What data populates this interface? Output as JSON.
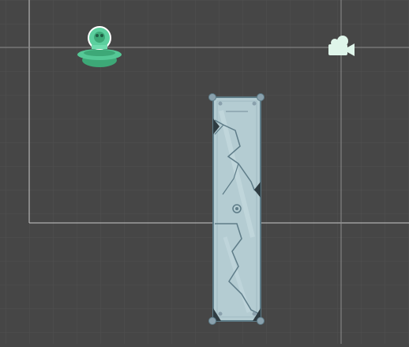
{
  "scene": {
    "view": "scene-view",
    "grid": true,
    "colors": {
      "background": "#464646",
      "grid_line": "#505050",
      "camera_bounds": "#c8c8c8",
      "gizmo_green": "#4fbf8f",
      "camera_icon": "#dff5ea",
      "tile_fill": "#b4ccd2",
      "tile_edge": "#5e7c88",
      "handle": "#8aa1ad"
    },
    "objects": [
      {
        "name": "alien-ufo-sprite",
        "icon": "ufo-icon"
      },
      {
        "name": "camera-gizmo",
        "icon": "camera-icon"
      },
      {
        "name": "stone-pillar-sprite",
        "icon": "cracked-stone-tile",
        "selected": true
      }
    ]
  }
}
